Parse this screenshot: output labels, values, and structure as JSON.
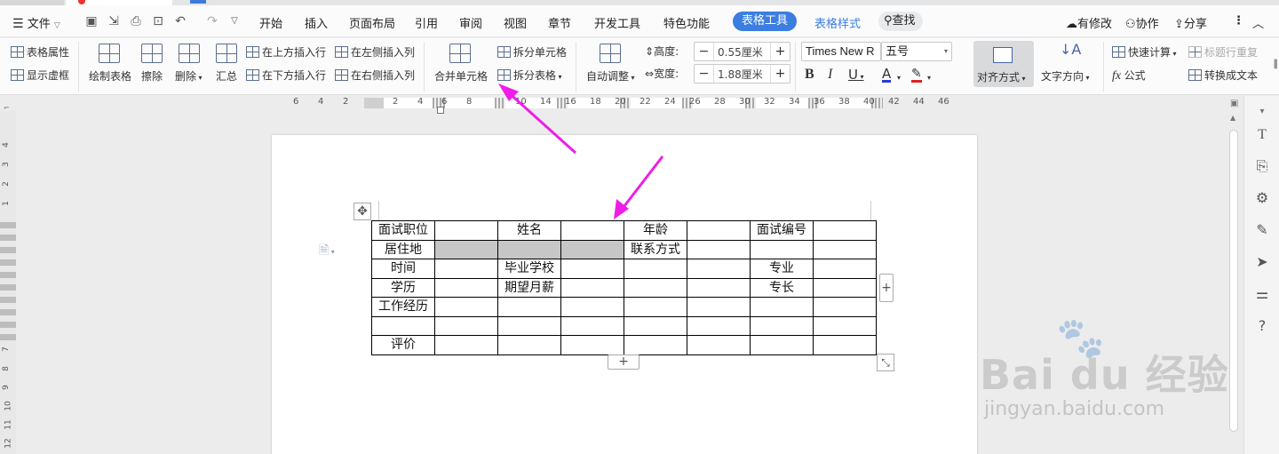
{
  "menubar": {
    "file_label": "文件",
    "tabs": [
      "开始",
      "插入",
      "页面布局",
      "引用",
      "审阅",
      "视图",
      "章节",
      "开发工具",
      "特色功能"
    ],
    "table_tools_tab": "表格工具",
    "table_style_tab": "表格样式",
    "search_label": "查找",
    "modified_label": "有修改",
    "collaborate_label": "协作",
    "share_label": "分享"
  },
  "ribbon": {
    "table_props": "表格属性",
    "show_gridlines": "显示虚框",
    "draw_table": "绘制表格",
    "erase": "擦除",
    "delete": "删除",
    "summary": "汇总",
    "insert_above": "在上方插入行",
    "insert_below": "在下方插入行",
    "insert_left": "在左侧插入列",
    "insert_right": "在右侧插入列",
    "merge_cells": "合并单元格",
    "split_cells": "拆分单元格",
    "split_table": "拆分表格",
    "auto_fit": "自动调整",
    "height_label": "高度:",
    "height_value": "0.55厘米",
    "width_label": "宽度:",
    "width_value": "1.88厘米",
    "font_name": "Times New R",
    "font_size": "五号",
    "align": "对齐方式",
    "text_direction": "文字方向",
    "quick_calc": "快速计算",
    "formula": "公式",
    "repeat_header": "标题行重复",
    "convert_text": "转换成文本"
  },
  "ruler": {
    "h_numbers": [
      "6",
      "4",
      "2",
      "2",
      "4",
      "6",
      "8",
      "10",
      "14",
      "16",
      "18",
      "20",
      "22",
      "24",
      "26",
      "28",
      "30",
      "32",
      "34",
      "36",
      "38",
      "40",
      "42",
      "44",
      "46"
    ],
    "v_numbers": [
      "4",
      "3",
      "2",
      "1",
      "7",
      "8",
      "9",
      "10",
      "11",
      "12"
    ]
  },
  "table": {
    "rows": [
      [
        "面试职位",
        "",
        "姓名",
        "",
        "年龄",
        "",
        "面试编号",
        ""
      ],
      [
        "居住地",
        "",
        "",
        "",
        "联系方式",
        "",
        "",
        ""
      ],
      [
        "时间",
        "",
        "毕业学校",
        "",
        "",
        "",
        "专业",
        ""
      ],
      [
        "学历",
        "",
        "期望月薪",
        "",
        "",
        "",
        "专长",
        ""
      ],
      [
        "工作经历",
        "",
        "",
        "",
        "",
        "",
        "",
        ""
      ],
      [
        "",
        "",
        "",
        "",
        "",
        "",
        "",
        ""
      ],
      [
        "评价",
        "",
        "",
        "",
        "",
        "",
        "",
        ""
      ]
    ]
  },
  "watermark": {
    "brand": "Bai du 经验",
    "url": "jingyan.baidu.com"
  },
  "colors": {
    "accent": "#3b7de0",
    "arrow": "#ee1ee6",
    "selected_cells": "#c6c6c6"
  }
}
